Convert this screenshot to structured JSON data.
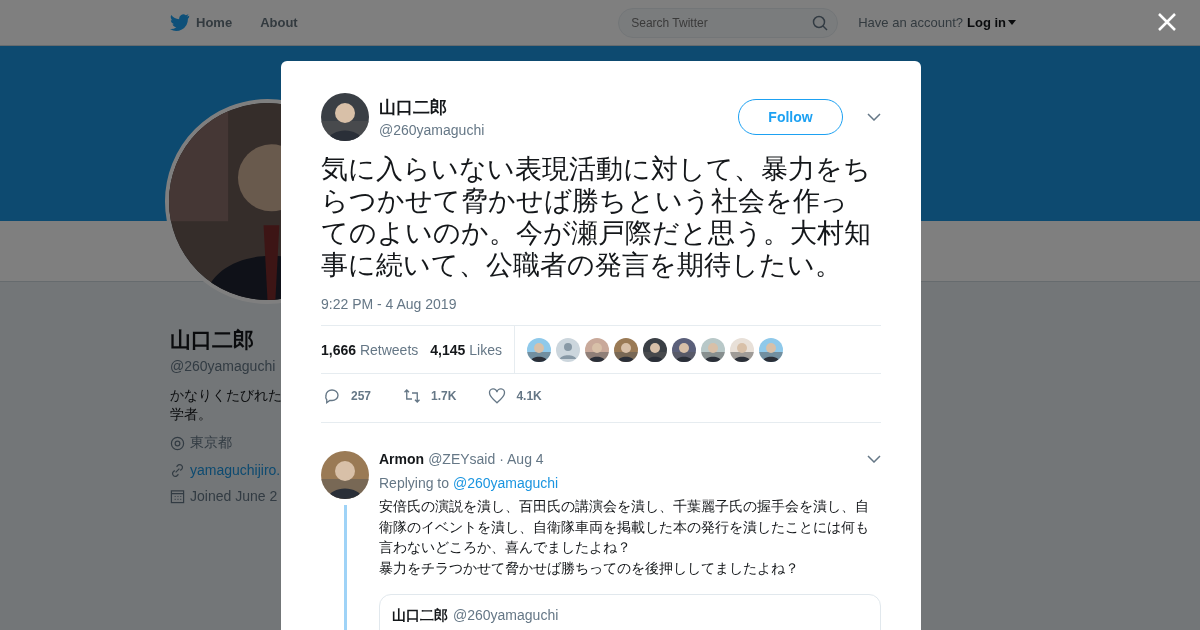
{
  "nav": {
    "items": [
      {
        "label": "Home",
        "kind": "home"
      },
      {
        "label": "About",
        "kind": "plain"
      }
    ],
    "search": {
      "placeholder": "Search Twitter"
    },
    "account_prompt": "Have an account?",
    "login": "Log in"
  },
  "profile": {
    "name": "山口二郎",
    "handle": "@260yamaguchi",
    "bio": [
      "かなりくたびれた",
      "学者。"
    ],
    "location": "東京都",
    "link": "yamaguchijiro.",
    "joined": "Joined June 2"
  },
  "tweet": {
    "author": {
      "name": "山口二郎",
      "handle": "@260yamaguchi"
    },
    "follow": "Follow",
    "text": "気に入らいない表現活動に対して、暴力をちらつかせて脅かせば勝ちという社会を作ってのよいのか。今が瀬戸際だと思う。大村知事に続いて、公職者の発言を期待したい。",
    "time": "9:22 PM - 4 Aug 2019",
    "retweets": {
      "count": "1,666",
      "label": "Retweets"
    },
    "likes": {
      "count": "4,145",
      "label": "Likes"
    },
    "likers": [
      {
        "kind": "picture"
      },
      {
        "kind": "default"
      },
      {
        "kind": "picture"
      },
      {
        "kind": "picture"
      },
      {
        "kind": "picture"
      },
      {
        "kind": "picture"
      },
      {
        "kind": "picture"
      },
      {
        "kind": "picture"
      },
      {
        "kind": "picture"
      }
    ],
    "actions": [
      {
        "kind": "reply",
        "count": "257"
      },
      {
        "kind": "retweet",
        "count": "1.7K"
      },
      {
        "kind": "like",
        "count": "4.1K"
      }
    ]
  },
  "reply": {
    "name": "Armon",
    "handle": "@ZEYsaid",
    "date": "· Aug 4",
    "replying_label": "Replying to",
    "replying_to": "@260yamaguchi",
    "paragraphs": [
      "安倍氏の演説を潰し、百田氏の講演会を潰し、千葉麗子氏の握手会を潰し、自衛隊のイベントを潰し、自衛隊車両を掲載した本の発行を潰したことには何も言わないどころか、喜んでましたよね？",
      "暴力をチラつかせて脅かせば勝ちってのを後押ししてましたよね？"
    ],
    "quote": {
      "name": "山口二郎",
      "handle": "@260yamaguchi"
    }
  }
}
